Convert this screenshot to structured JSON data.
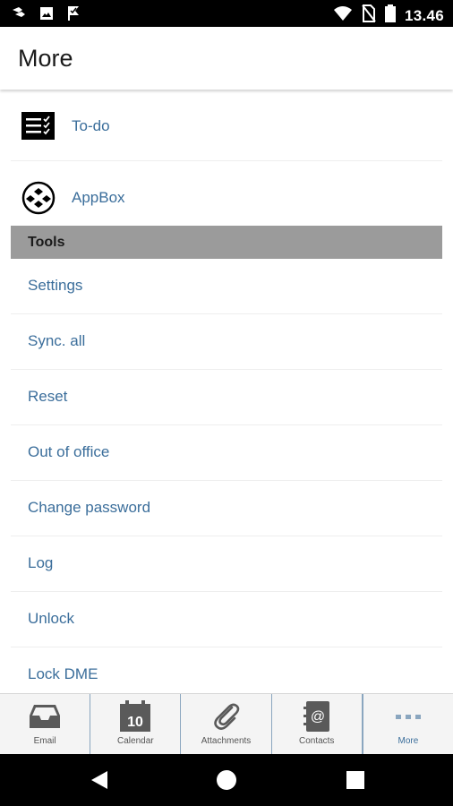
{
  "status_bar": {
    "time": "13.46",
    "icons": [
      "dme-notification-icon",
      "image-icon",
      "check-flag-icon",
      "wifi-icon",
      "no-sim-icon",
      "battery-icon"
    ]
  },
  "header": {
    "title": "More"
  },
  "apps": [
    {
      "label": "To-do",
      "icon": "todo-list-icon"
    },
    {
      "label": "AppBox",
      "icon": "appbox-icon"
    }
  ],
  "tools_section": {
    "title": "Tools",
    "items": [
      {
        "label": "Settings"
      },
      {
        "label": "Sync. all"
      },
      {
        "label": "Reset"
      },
      {
        "label": "Out of office"
      },
      {
        "label": "Change password"
      },
      {
        "label": "Log"
      },
      {
        "label": "Unlock"
      },
      {
        "label": "Lock DME"
      }
    ]
  },
  "tab_bar": {
    "active": "More",
    "tabs": [
      {
        "label": "Email",
        "icon": "inbox-icon"
      },
      {
        "label": "Calendar",
        "icon": "calendar-icon",
        "badge": "10"
      },
      {
        "label": "Attachments",
        "icon": "paperclip-icon"
      },
      {
        "label": "Contacts",
        "icon": "contacts-icon"
      },
      {
        "label": "More",
        "icon": "more-dots-icon"
      }
    ]
  },
  "nav_bar": {
    "buttons": [
      "back-icon",
      "home-icon",
      "recents-icon"
    ]
  },
  "colors": {
    "link_blue": "#3b6e9b",
    "section_gray": "#9b9b9b",
    "tab_bg": "#f4f4f4"
  }
}
